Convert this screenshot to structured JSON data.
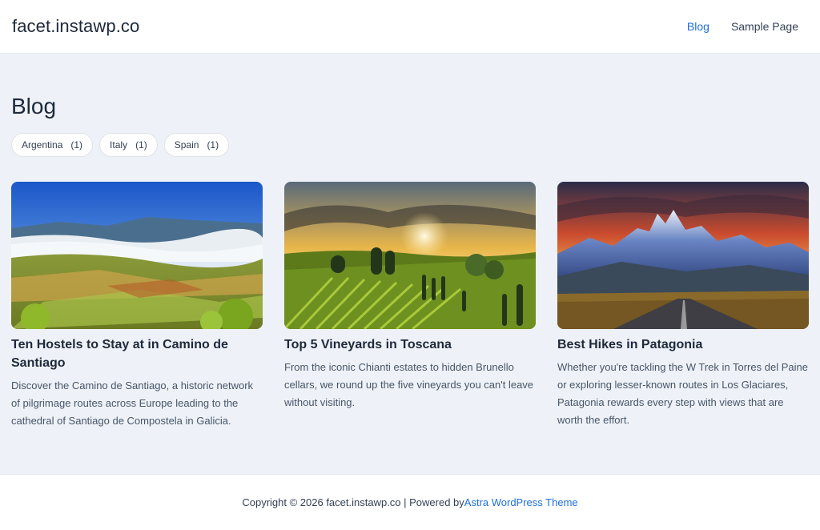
{
  "header": {
    "site_title": "facet.instawp.co",
    "nav": [
      {
        "label": "Blog"
      },
      {
        "label": "Sample Page"
      }
    ]
  },
  "main": {
    "title": "Blog",
    "facets": [
      {
        "label": "Argentina",
        "count": "(1)"
      },
      {
        "label": "Italy",
        "count": "(1)"
      },
      {
        "label": "Spain",
        "count": "(1)"
      }
    ],
    "posts": [
      {
        "title": "Ten Hostels to Stay at in Camino de Santiago",
        "excerpt": "Discover the Camino de Santiago, a historic network of pilgrimage routes across Europe leading to the cathedral of Santiago de Compostela in Galicia."
      },
      {
        "title": "Top 5 Vineyards in Toscana",
        "excerpt": "From the iconic Chianti estates to hidden Brunello cellars, we round up the five vineyards you can't leave without visiting."
      },
      {
        "title": "Best Hikes in Patagonia",
        "excerpt": "Whether you're tackling the W Trek in Torres del Paine or exploring lesser-known routes in Los Glaciares, Patagonia rewards every step with views that are worth the effort."
      }
    ]
  },
  "footer": {
    "text": "Copyright © 2026 facet.instawp.co | Powered by ",
    "link": "Astra WordPress Theme"
  },
  "colors": {
    "accent": "#1e6fd9",
    "page_bg": "#eef2f8"
  }
}
